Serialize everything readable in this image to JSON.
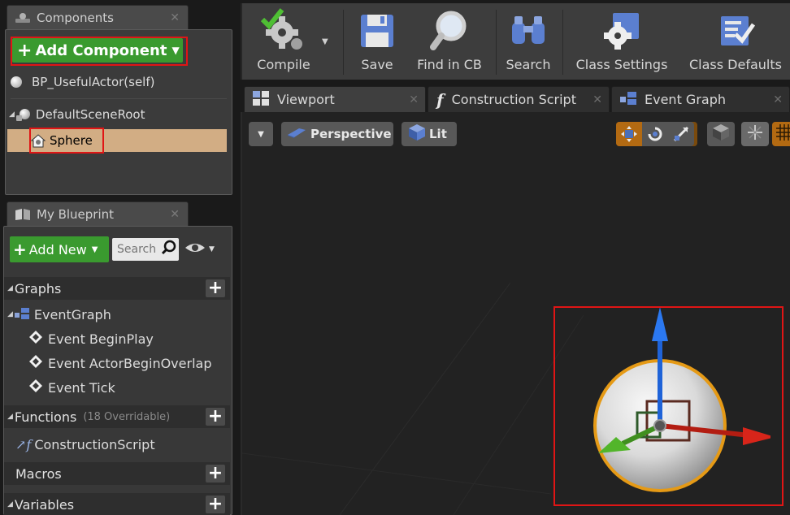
{
  "components_panel": {
    "tab_title": "Components",
    "add_component_label": "Add Component",
    "self_label": "BP_UsefulActor(self)",
    "root_label": "DefaultSceneRoot",
    "selected_label": "Sphere"
  },
  "my_blueprint_panel": {
    "tab_title": "My Blueprint",
    "add_new_label": "Add New",
    "search_placeholder": "Search",
    "graphs_label": "Graphs",
    "event_graph_label": "EventGraph",
    "events": [
      "Event BeginPlay",
      "Event ActorBeginOverlap",
      "Event Tick"
    ],
    "functions_label": "Functions",
    "functions_override": "(18 Overridable)",
    "construction_script_label": "ConstructionScript",
    "macros_label": "Macros",
    "variables_label": "Variables"
  },
  "toolbar": {
    "compile": "Compile",
    "save": "Save",
    "find_in_cb": "Find in CB",
    "search": "Search",
    "class_settings": "Class Settings",
    "class_defaults": "Class Defaults"
  },
  "editor_tabs": {
    "viewport": "Viewport",
    "construction_script": "Construction Script",
    "event_graph": "Event Graph"
  },
  "viewport": {
    "perspective_label": "Perspective",
    "lit_label": "Lit"
  },
  "colors": {
    "highlight_red": "#e01515",
    "green_button": "#3a9a2f",
    "selection_tan": "#d2ad84"
  }
}
